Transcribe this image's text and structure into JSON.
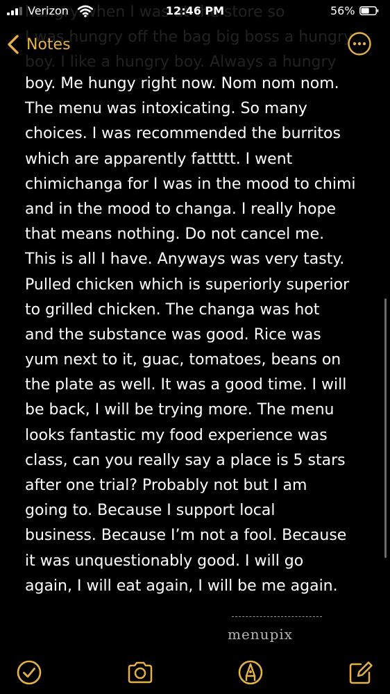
{
  "status_bar": {
    "carrier": "Verizon",
    "time": "12:46 PM",
    "battery_percent": "56%",
    "battery_level": 0.56,
    "signal_bars": 3,
    "icons": [
      "signal-icon",
      "wifi-icon",
      "battery-icon"
    ]
  },
  "nav": {
    "back_label": "Notes",
    "back_icon": "chevron-left-icon",
    "more_icon": "ellipsis-circle-icon"
  },
  "colors": {
    "background": "#000000",
    "text": "#ffffff",
    "accent": "#e5b14a"
  },
  "note": {
    "faded_lines": [
      "hungry when I was at the store so",
      "I was hungry off the bag big boss a hungry",
      "boy. I like a hungry boy. Always a hungry"
    ],
    "lines": [
      "boy. Me hungy right now. Nom nom nom.",
      "The menu was intoxicating. So many",
      "choices. I was recommended the burritos",
      "which are apparently fattttt. I went",
      "chimichanga for I was in the mood to chimi",
      "and in the mood to changa. I really hope",
      "that means nothing. Do not cancel me.",
      "This is all I have. Anyways was very tasty.",
      "Pulled chicken which is superiorly superior",
      "to grilled chicken. The changa was hot",
      "and the substance was good. Rice was",
      "yum next to it, guac, tomatoes, beans on",
      "the plate as well. It was a good time. I will",
      "be back, I will be trying more. The menu",
      "looks fantastic my food experience was",
      "class, can you really say a place is 5 stars",
      "after one trial? Probably not but I am",
      "going to. Because I support local",
      "business. Because I’m not a fool. Because",
      "it was unquestionably good. I will go",
      "again, I will eat again, I will be me again."
    ]
  },
  "watermark": {
    "text": "menupix"
  },
  "toolbar": {
    "items": [
      {
        "name": "checklist",
        "icon": "checkmark-circle-icon"
      },
      {
        "name": "camera",
        "icon": "camera-icon"
      },
      {
        "name": "markup",
        "icon": "pen-tip-circle-icon"
      },
      {
        "name": "compose",
        "icon": "compose-icon"
      }
    ]
  }
}
